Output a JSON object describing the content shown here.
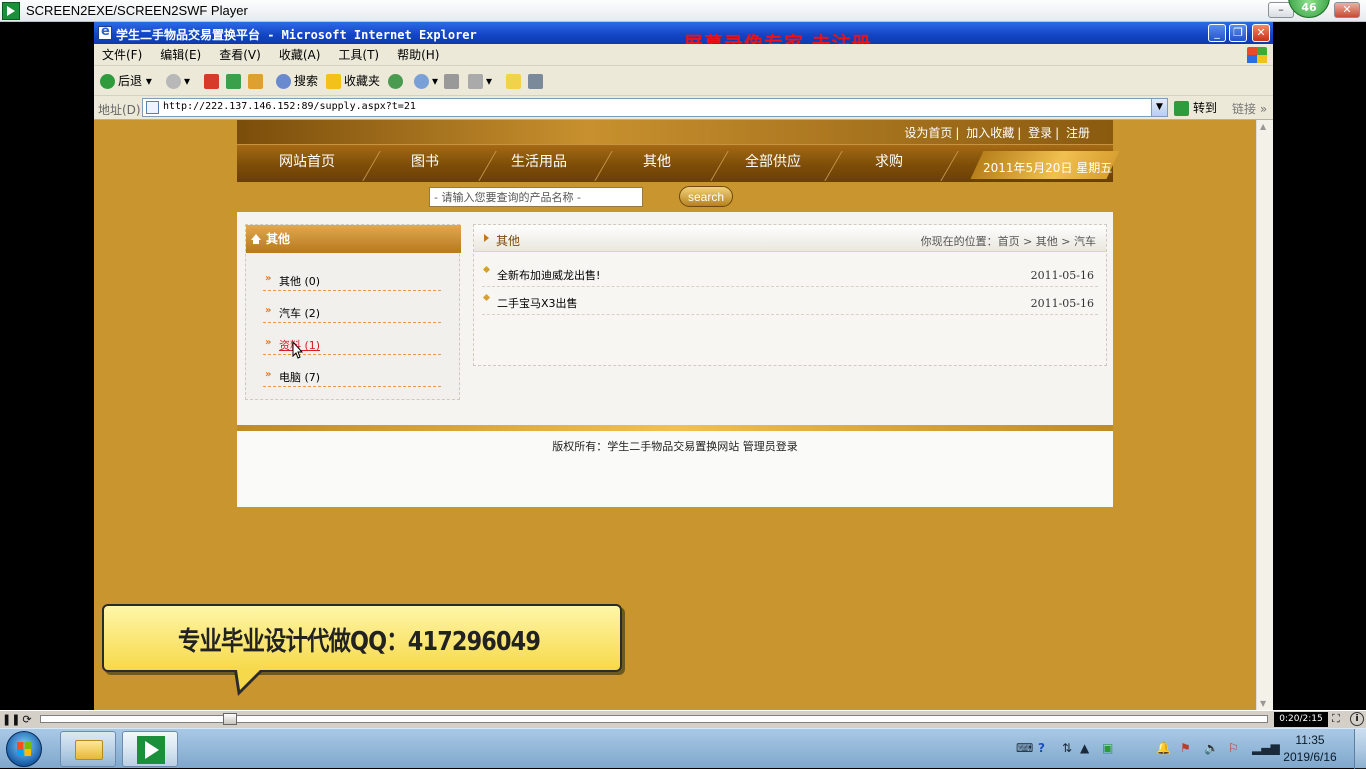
{
  "player": {
    "title": "SCREEN2EXE/SCREEN2SWF Player",
    "badge": "46",
    "time": "0:20/2:15",
    "progress": 0.15
  },
  "ie": {
    "title": "学生二手物品交易置换平台 - Microsoft Internet Explorer",
    "watermark": "屏幕录像专家 未注册",
    "menu": [
      "文件(F)",
      "编辑(E)",
      "查看(V)",
      "收藏(A)",
      "工具(T)",
      "帮助(H)"
    ],
    "toolbar": {
      "back": "后退",
      "search": "搜索",
      "favorites": "收藏夹"
    },
    "address_label": "地址(D)",
    "url": "http://222.137.146.152:89/supply.aspx?t=21",
    "go": "转到",
    "links": "链接"
  },
  "site": {
    "top_links": [
      "设为首页",
      "加入收藏",
      "登录",
      "注册"
    ],
    "nav": [
      "网站首页",
      "图书",
      "生活用品",
      "其他",
      "全部供应",
      "求购"
    ],
    "date": "2011年5月20日 星期五",
    "search_placeholder": "- 请输入您要查询的产品名称 -",
    "search_button": "search",
    "sidebar_title": "其他",
    "categories": [
      {
        "label": "其他 (0)"
      },
      {
        "label": "汽车 (2)"
      },
      {
        "label": "资料 (1)"
      },
      {
        "label": "电脑 (7)"
      }
    ],
    "content_title": "其他",
    "breadcrumb": "你现在的位置：首页 > 其他 > 汽车",
    "posts": [
      {
        "title": "全新布加迪威龙出售!",
        "date": "2011-05-16"
      },
      {
        "title": "二手宝马X3出售",
        "date": "2011-05-16"
      }
    ],
    "footer": "版权所有：学生二手物品交易置换网站 管理员登录"
  },
  "ad": "专业毕业设计代做QQ：417296049",
  "taskbar": {
    "time": "11:35",
    "date": "2019/6/16"
  }
}
